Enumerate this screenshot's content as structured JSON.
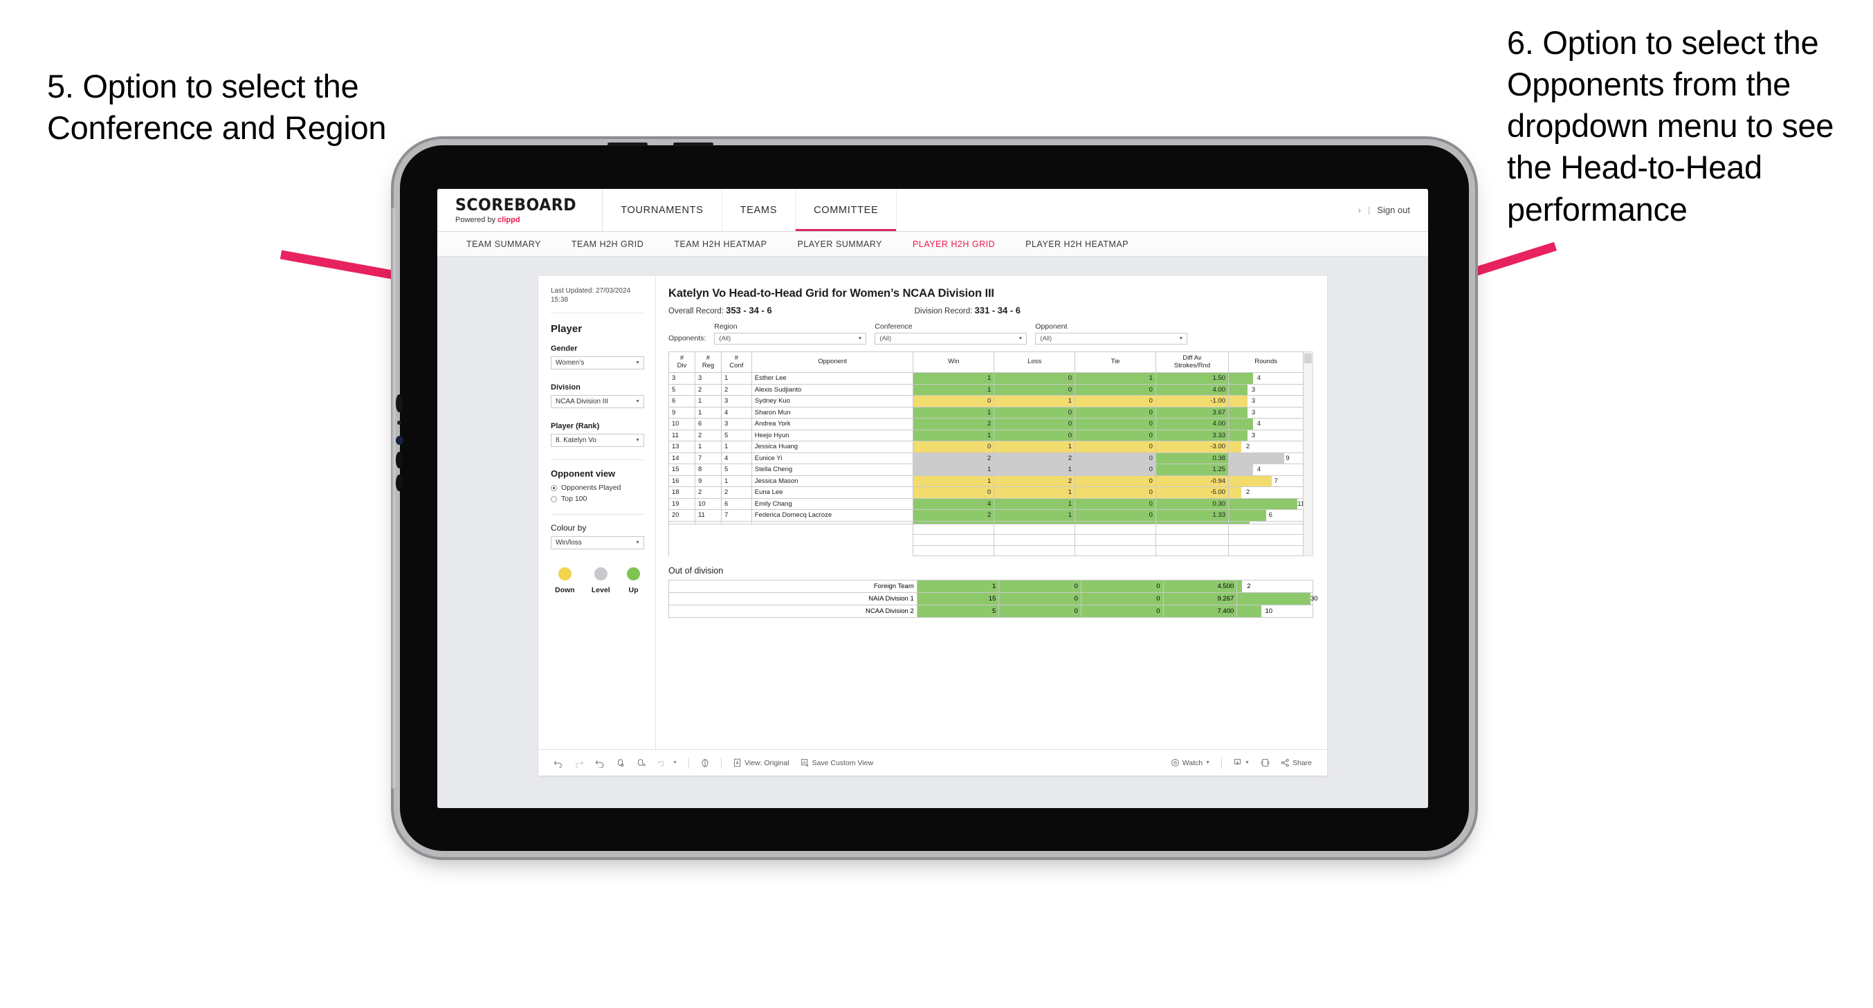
{
  "annotations": {
    "left": "5. Option to select the Conference and Region",
    "right": "6. Option to select the Opponents from the dropdown menu to see the Head-to-Head performance",
    "arrow_color": "#E8225F"
  },
  "app": {
    "brand": {
      "title": "SCOREBOARD",
      "powered_prefix": "Powered by ",
      "powered_brand": "clippd"
    },
    "topnav": [
      {
        "label": "TOURNAMENTS",
        "active": false
      },
      {
        "label": "TEAMS",
        "active": false
      },
      {
        "label": "COMMITTEE",
        "active": true
      }
    ],
    "account": {
      "chevron": "›",
      "divider": "|",
      "signout": "Sign out"
    },
    "subtabs": [
      {
        "label": "TEAM SUMMARY",
        "active": false
      },
      {
        "label": "TEAM H2H GRID",
        "active": false
      },
      {
        "label": "TEAM H2H HEATMAP",
        "active": false
      },
      {
        "label": "PLAYER SUMMARY",
        "active": false
      },
      {
        "label": "PLAYER H2H GRID",
        "active": true
      },
      {
        "label": "PLAYER H2H HEATMAP",
        "active": false
      }
    ]
  },
  "sidebar": {
    "last_updated": "Last Updated: 27/03/2024 15:38",
    "heading": "Player",
    "gender": {
      "label": "Gender",
      "value": "Women’s"
    },
    "division": {
      "label": "Division",
      "value": "NCAA Division III"
    },
    "player": {
      "label": "Player (Rank)",
      "value": "8. Katelyn Vo"
    },
    "opponent_view": {
      "heading": "Opponent view",
      "options": [
        {
          "label": "Opponents Played",
          "selected": true
        },
        {
          "label": "Top 100",
          "selected": false
        }
      ]
    },
    "colour_by": {
      "label": "Colour by",
      "value": "Win/loss"
    },
    "legend": [
      {
        "label": "Down",
        "color": "#F2D34F"
      },
      {
        "label": "Level",
        "color": "#C7C9CC"
      },
      {
        "label": "Up",
        "color": "#7FC451"
      }
    ]
  },
  "viz": {
    "title": "Katelyn Vo Head-to-Head Grid for Women’s NCAA Division III",
    "overall_record_label": "Overall Record:",
    "overall_record_value": "353 - 34 - 6",
    "division_record_label": "Division Record:",
    "division_record_value": "331 -  34 - 6",
    "filters": {
      "left_label": "Opponents:",
      "items": [
        {
          "title": "Region",
          "value": "(All)"
        },
        {
          "title": "Conference",
          "value": "(All)"
        },
        {
          "title": "Opponent",
          "value": "(All)"
        }
      ]
    },
    "columns": [
      "# Div",
      "# Reg",
      "# Conf",
      "Opponent",
      "Win",
      "Loss",
      "Tie",
      "Diff Av Strokes/Rnd",
      "Rounds"
    ],
    "rows": [
      {
        "div": "3",
        "reg": "3",
        "conf": "1",
        "opponent": "Esther Lee",
        "win": "1",
        "loss": "0",
        "tie": "1",
        "diff": "1.50",
        "rounds": 4,
        "color": "#8DC96B"
      },
      {
        "div": "5",
        "reg": "2",
        "conf": "2",
        "opponent": "Alexis Sudjianto",
        "win": "1",
        "loss": "0",
        "tie": "0",
        "diff": "4.00",
        "rounds": 3,
        "color": "#8DC96B"
      },
      {
        "div": "6",
        "reg": "1",
        "conf": "3",
        "opponent": "Sydney Kuo",
        "win": "0",
        "loss": "1",
        "tie": "0",
        "diff": "-1.00",
        "rounds": 3,
        "color": "#F2DC6E"
      },
      {
        "div": "9",
        "reg": "1",
        "conf": "4",
        "opponent": "Sharon Mun",
        "win": "1",
        "loss": "0",
        "tie": "0",
        "diff": "3.67",
        "rounds": 3,
        "color": "#8DC96B"
      },
      {
        "div": "10",
        "reg": "6",
        "conf": "3",
        "opponent": "Andrea York",
        "win": "2",
        "loss": "0",
        "tie": "0",
        "diff": "4.00",
        "rounds": 4,
        "color": "#8DC96B"
      },
      {
        "div": "11",
        "reg": "2",
        "conf": "5",
        "opponent": "Heejo Hyun",
        "win": "1",
        "loss": "0",
        "tie": "0",
        "diff": "3.33",
        "rounds": 3,
        "color": "#8DC96B"
      },
      {
        "div": "13",
        "reg": "1",
        "conf": "1",
        "opponent": "Jessica Huang",
        "win": "0",
        "loss": "1",
        "tie": "0",
        "diff": "-3.00",
        "rounds": 2,
        "color": "#F2DC6E"
      },
      {
        "div": "14",
        "reg": "7",
        "conf": "4",
        "opponent": "Eunice Yi",
        "win": "2",
        "loss": "2",
        "tie": "0",
        "diff": "0.38",
        "rounds": 9,
        "color": "#CCCCCC",
        "diff_color": "#8DC96B"
      },
      {
        "div": "15",
        "reg": "8",
        "conf": "5",
        "opponent": "Stella Cheng",
        "win": "1",
        "loss": "1",
        "tie": "0",
        "diff": "1.25",
        "rounds": 4,
        "color": "#CCCCCC",
        "diff_color": "#8DC96B"
      },
      {
        "div": "16",
        "reg": "9",
        "conf": "1",
        "opponent": "Jessica Mason",
        "win": "1",
        "loss": "2",
        "tie": "0",
        "diff": "-0.94",
        "rounds": 7,
        "color": "#F2DC6E"
      },
      {
        "div": "18",
        "reg": "2",
        "conf": "2",
        "opponent": "Euna Lee",
        "win": "0",
        "loss": "1",
        "tie": "0",
        "diff": "-5.00",
        "rounds": 2,
        "color": "#F2DC6E"
      },
      {
        "div": "19",
        "reg": "10",
        "conf": "6",
        "opponent": "Emily Chang",
        "win": "4",
        "loss": "1",
        "tie": "0",
        "diff": "0.30",
        "rounds": 11,
        "color": "#8DC96B"
      },
      {
        "div": "20",
        "reg": "11",
        "conf": "7",
        "opponent": "Federica Domecq Lacroze",
        "win": "2",
        "loss": "1",
        "tie": "0",
        "diff": "1.33",
        "rounds": 6,
        "color": "#8DC96B"
      }
    ],
    "rounds_max": 12,
    "out_of_division": {
      "title": "Out of division",
      "rows": [
        {
          "name": "Foreign Team",
          "win": "1",
          "loss": "0",
          "tie": "0",
          "diff": "4.500",
          "rounds": 2,
          "color": "#8DC96B"
        },
        {
          "name": "NAIA Division 1",
          "win": "15",
          "loss": "0",
          "tie": "0",
          "diff": "9.267",
          "rounds": 30,
          "color": "#8DC96B"
        },
        {
          "name": "NCAA Division 2",
          "win": "5",
          "loss": "0",
          "tie": "0",
          "diff": "7.400",
          "rounds": 10,
          "color": "#8DC96B"
        }
      ],
      "rounds_max": 31
    }
  },
  "toolbar": {
    "items": [
      {
        "name": "undo-icon",
        "label": ""
      },
      {
        "name": "redo-icon",
        "label": ""
      },
      {
        "name": "revert-icon",
        "label": ""
      },
      {
        "name": "refresh-data-icon",
        "label": ""
      },
      {
        "name": "pause-auto-update-icon",
        "label": ""
      },
      {
        "name": "dropdown-arrow-icon",
        "label": ""
      },
      {
        "name": "pause-icon",
        "label": ""
      },
      {
        "name": "view-original-icon",
        "label": "View: Original"
      },
      {
        "name": "save-custom-view-icon",
        "label": "Save Custom View"
      },
      {
        "name": "watch-icon",
        "label": "Watch"
      },
      {
        "name": "download-icon",
        "label": ""
      },
      {
        "name": "fullscreen-icon",
        "label": ""
      },
      {
        "name": "share-icon",
        "label": "Share"
      }
    ]
  }
}
